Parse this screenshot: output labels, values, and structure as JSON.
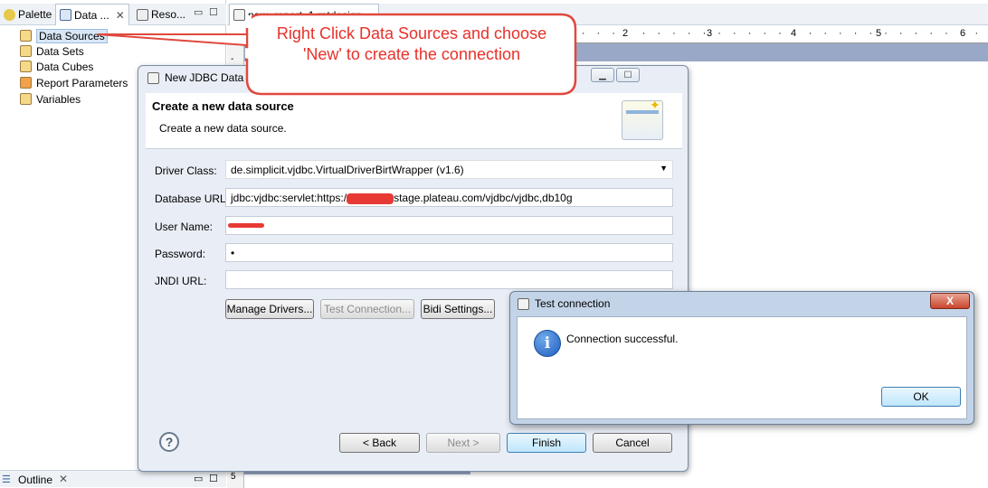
{
  "left_panel": {
    "tabs": [
      {
        "label": "Palette"
      },
      {
        "label": "Data ..."
      },
      {
        "label": "Reso..."
      }
    ],
    "tree": [
      {
        "label": "Data Sources"
      },
      {
        "label": "Data Sets"
      },
      {
        "label": "Data Cubes"
      },
      {
        "label": "Report Parameters"
      },
      {
        "label": "Variables"
      }
    ],
    "outline_tab": "Outline"
  },
  "editor": {
    "tab_label": "new_report_1.rptdesign",
    "ruler_marks": [
      "2",
      "3",
      "4",
      "5",
      "6"
    ]
  },
  "callout": {
    "text": "Right Click Data Sources and choose 'New' to create the connection"
  },
  "dialog": {
    "title": "New JDBC Data Source Profile",
    "header_title": "Create a new data source",
    "header_desc": "Create a new data source.",
    "fields": {
      "driver_class_label": "Driver Class:",
      "driver_class_value": "de.simplicit.vjdbc.VirtualDriverBirtWrapper (v1.6)",
      "database_url_label": "Database URL:",
      "database_url_prefix": "jdbc:vjdbc:servlet:https:/",
      "database_url_suffix": "stage.plateau.com/vjdbc/vjdbc,db10g",
      "user_name_label": "User Name:",
      "password_label": "Password:",
      "password_value": "•",
      "jndi_url_label": "JNDI URL:"
    },
    "buttons": {
      "manage_drivers": "Manage Drivers...",
      "test_connection": "Test Connection...",
      "bidi_settings": "Bidi Settings...",
      "back": "< Back",
      "next": "Next >",
      "finish": "Finish",
      "cancel": "Cancel"
    }
  },
  "popup": {
    "title": "Test connection",
    "message": "Connection successful.",
    "ok_label": "OK",
    "close_label": "X"
  }
}
